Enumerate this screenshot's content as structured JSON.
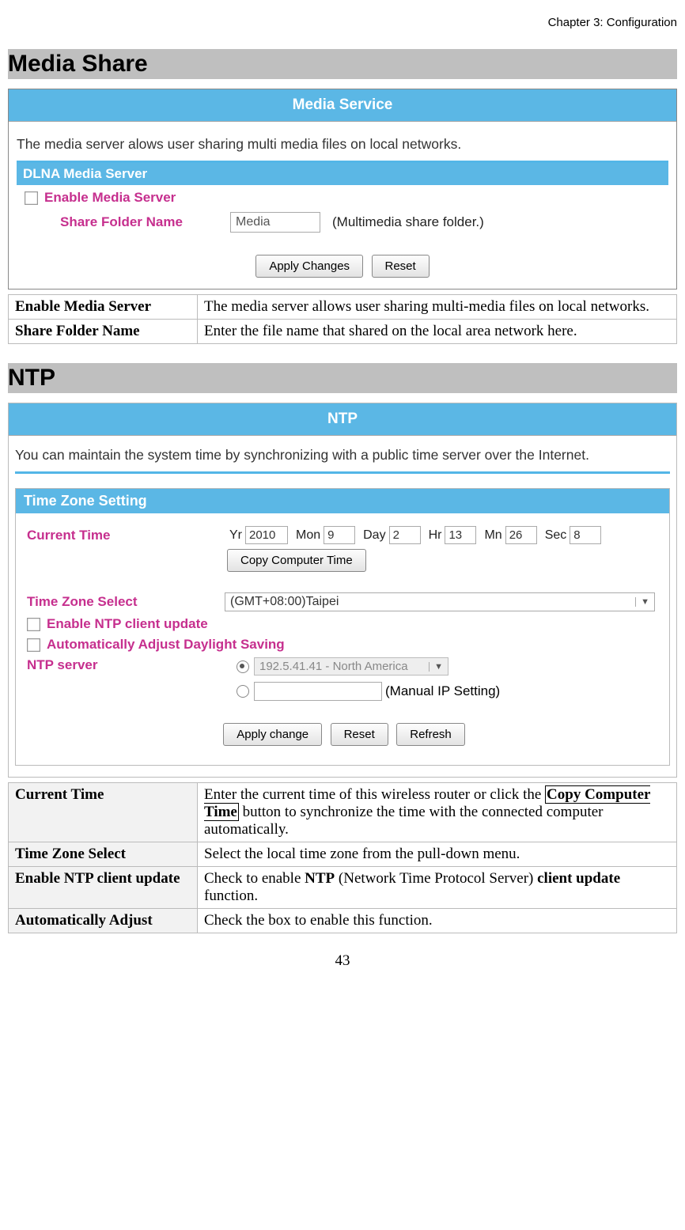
{
  "chapter": "Chapter 3: Configuration",
  "section1": {
    "heading": "Media Share",
    "panel_title": "Media Service",
    "intro": "The media server alows user sharing multi media files on local networks.",
    "sub_header": "DLNA Media Server",
    "enable_label": "Enable Media Server",
    "share_label": "Share Folder Name",
    "share_value": "Media",
    "share_hint": "(Multimedia share folder.)",
    "apply_btn": "Apply Changes",
    "reset_btn": "Reset",
    "defs": [
      {
        "term": "Enable Media Server",
        "desc": "The media server allows user sharing multi-media files on local networks."
      },
      {
        "term": "Share Folder Name",
        "desc": "Enter the file name that shared on the local area network here."
      }
    ]
  },
  "section2": {
    "heading": "NTP",
    "panel_title": "NTP",
    "intro": "You can maintain the system time by synchronizing with a public time server over the Internet.",
    "tz_header": "Time Zone Setting",
    "current_time_label": "Current Time",
    "yr_lbl": "Yr",
    "yr_val": "2010",
    "mon_lbl": "Mon",
    "mon_val": "9",
    "day_lbl": "Day",
    "day_val": "2",
    "hr_lbl": "Hr",
    "hr_val": "13",
    "mn_lbl": "Mn",
    "mn_val": "26",
    "sec_lbl": "Sec",
    "sec_val": "8",
    "copy_btn": "Copy Computer Time",
    "tz_select_label": "Time Zone Select",
    "tz_select_value": "(GMT+08:00)Taipei",
    "enable_ntp_label": "Enable NTP client update",
    "auto_dst_label": "Automatically Adjust Daylight Saving",
    "ntp_server_label": "NTP server",
    "ntp_option1": "192.5.41.41 - North America",
    "manual_label": "(Manual IP Setting)",
    "apply_btn": "Apply change",
    "reset_btn": "Reset",
    "refresh_btn": "Refresh",
    "defs": {
      "r1_term": "Current Time",
      "r1_pre": "Enter the current time of this wireless router or click the ",
      "r1_box": "Copy Computer Time",
      "r1_post": " button to synchronize the time with the connected computer automatically.",
      "r2_term": "Time Zone Select",
      "r2_desc": "Select the local time zone from the pull-down menu.",
      "r3_term": "Enable NTP client update",
      "r3_pre": "Check to enable ",
      "r3_b1": "NTP",
      "r3_mid": " (Network Time Protocol Server) ",
      "r3_b2": "client update",
      "r3_post": " function.",
      "r4_term": "Automatically Adjust",
      "r4_desc": "Check the box to enable this function."
    }
  },
  "page_number": "43"
}
